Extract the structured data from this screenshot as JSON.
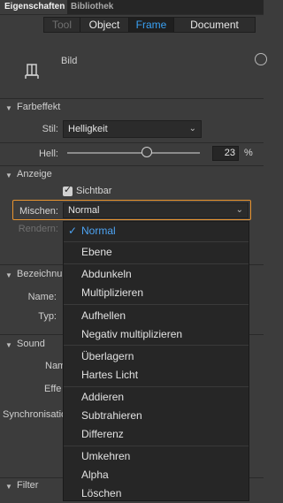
{
  "panel_tabs": {
    "active": "Eigenschaften",
    "inactive": "Bibliothek"
  },
  "segments": [
    {
      "label": "Tool",
      "state": "disabled"
    },
    {
      "label": "Object",
      "state": "normal"
    },
    {
      "label": "Frame",
      "state": "selected"
    },
    {
      "label": "Document",
      "state": "normal"
    }
  ],
  "bild_label": "Bild",
  "farbeffekt": {
    "title": "Farbeffekt",
    "stil_label": "Stil:",
    "stil_value": "Helligkeit",
    "hell_label": "Hell:",
    "hell_value": "23",
    "hell_unit": "%",
    "slider_level": 0.6
  },
  "anzeige": {
    "title": "Anzeige",
    "sichtbar_label": "Sichtbar",
    "mischen_label": "Mischen:",
    "mischen_value": "Normal",
    "rendern_label": "Rendern:"
  },
  "behind": {
    "bezeichnung_title": "Bezeichnun",
    "name_label": "Name:",
    "typ_label": "Typ:",
    "sound_title": "Sound",
    "nam_label": "Nam",
    "effe_label": "Effe",
    "sync_label": "Synchronisatio",
    "filter_title": "Filter"
  },
  "menu_items": [
    "Normal",
    "Ebene",
    "Abdunkeln",
    "Multiplizieren",
    "Aufhellen",
    "Negativ multiplizieren",
    "Überlagern",
    "Hartes Licht",
    "Addieren",
    "Subtrahieren",
    "Differenz",
    "Umkehren",
    "Alpha",
    "Löschen"
  ],
  "colors": {
    "accent": "#39a1f4",
    "highlight": "#e8932f",
    "panel": "#3c3c3c"
  }
}
